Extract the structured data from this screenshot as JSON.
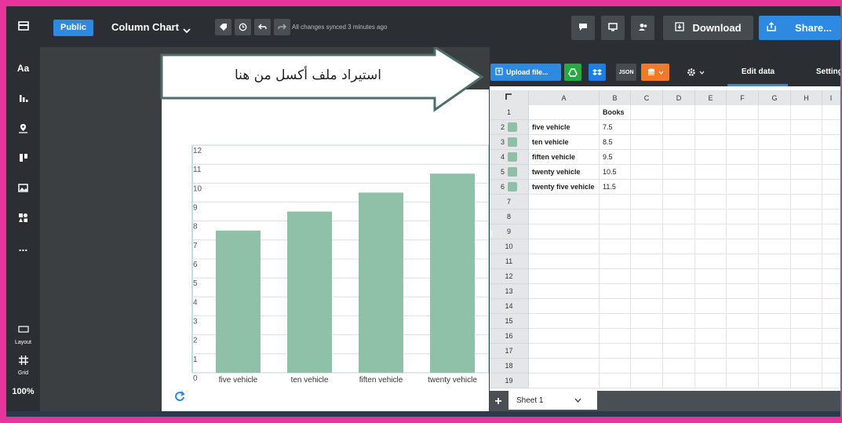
{
  "header": {
    "visibility_label": "Public",
    "chart_type_label": "Column Chart",
    "sync_status": "All changes synced 3 minutes ago",
    "download_label": "Download",
    "share_label": "Share..."
  },
  "sidebar": {
    "items": [
      {
        "name": "layout-icon"
      },
      {
        "name": "text-icon",
        "label": "Aa"
      },
      {
        "name": "chart-icon"
      },
      {
        "name": "map-pin-icon"
      },
      {
        "name": "columns-icon"
      },
      {
        "name": "image-icon"
      },
      {
        "name": "shapes-icon"
      },
      {
        "name": "more-icon",
        "label": "..."
      }
    ],
    "layout_label": "Layout",
    "grid_label": "Grid",
    "zoom_label": "100%"
  },
  "callout": {
    "text": "استيراد ملف أكسل من هنا"
  },
  "data_panel": {
    "upload_label": "Upload file...",
    "json_label": "JSON",
    "tab_edit": "Edit data",
    "tab_settings": "Settings",
    "columns": [
      "A",
      "B",
      "C",
      "D",
      "E",
      "F",
      "G",
      "H",
      "I"
    ],
    "rows": [
      {
        "n": "1",
        "a": "",
        "b": "Books"
      },
      {
        "n": "2",
        "a": "five vehicle",
        "b": "7.5"
      },
      {
        "n": "3",
        "a": "ten vehicle",
        "b": "8.5"
      },
      {
        "n": "4",
        "a": "fiften vehicle",
        "b": "9.5"
      },
      {
        "n": "5",
        "a": "twenty vehicle",
        "b": "10.5"
      },
      {
        "n": "6",
        "a": "twenty five vehicle",
        "b": "11.5"
      },
      {
        "n": "7",
        "a": "",
        "b": ""
      },
      {
        "n": "8",
        "a": "",
        "b": ""
      },
      {
        "n": "9",
        "a": "",
        "b": ""
      },
      {
        "n": "10",
        "a": "",
        "b": ""
      },
      {
        "n": "11",
        "a": "",
        "b": ""
      },
      {
        "n": "12",
        "a": "",
        "b": ""
      },
      {
        "n": "13",
        "a": "",
        "b": ""
      },
      {
        "n": "14",
        "a": "",
        "b": ""
      },
      {
        "n": "15",
        "a": "",
        "b": ""
      },
      {
        "n": "16",
        "a": "",
        "b": ""
      },
      {
        "n": "17",
        "a": "",
        "b": ""
      },
      {
        "n": "18",
        "a": "",
        "b": ""
      },
      {
        "n": "19",
        "a": "",
        "b": ""
      }
    ],
    "sheet_label": "Sheet 1"
  },
  "chart_data": {
    "type": "bar",
    "categories": [
      "five vehicle",
      "ten vehicle",
      "fiften vehicle",
      "twenty vehicle"
    ],
    "values": [
      7.5,
      8.5,
      9.5,
      10.5
    ],
    "ylim": [
      0,
      12
    ],
    "yticks": [
      "0",
      "1",
      "2",
      "3",
      "4",
      "5",
      "6",
      "7",
      "8",
      "9",
      "10",
      "11",
      "12"
    ],
    "bar_color": "#8fc1a8",
    "grid": true
  },
  "colors": {
    "accent": "#2d8ae0",
    "frame": "#e6359a"
  }
}
